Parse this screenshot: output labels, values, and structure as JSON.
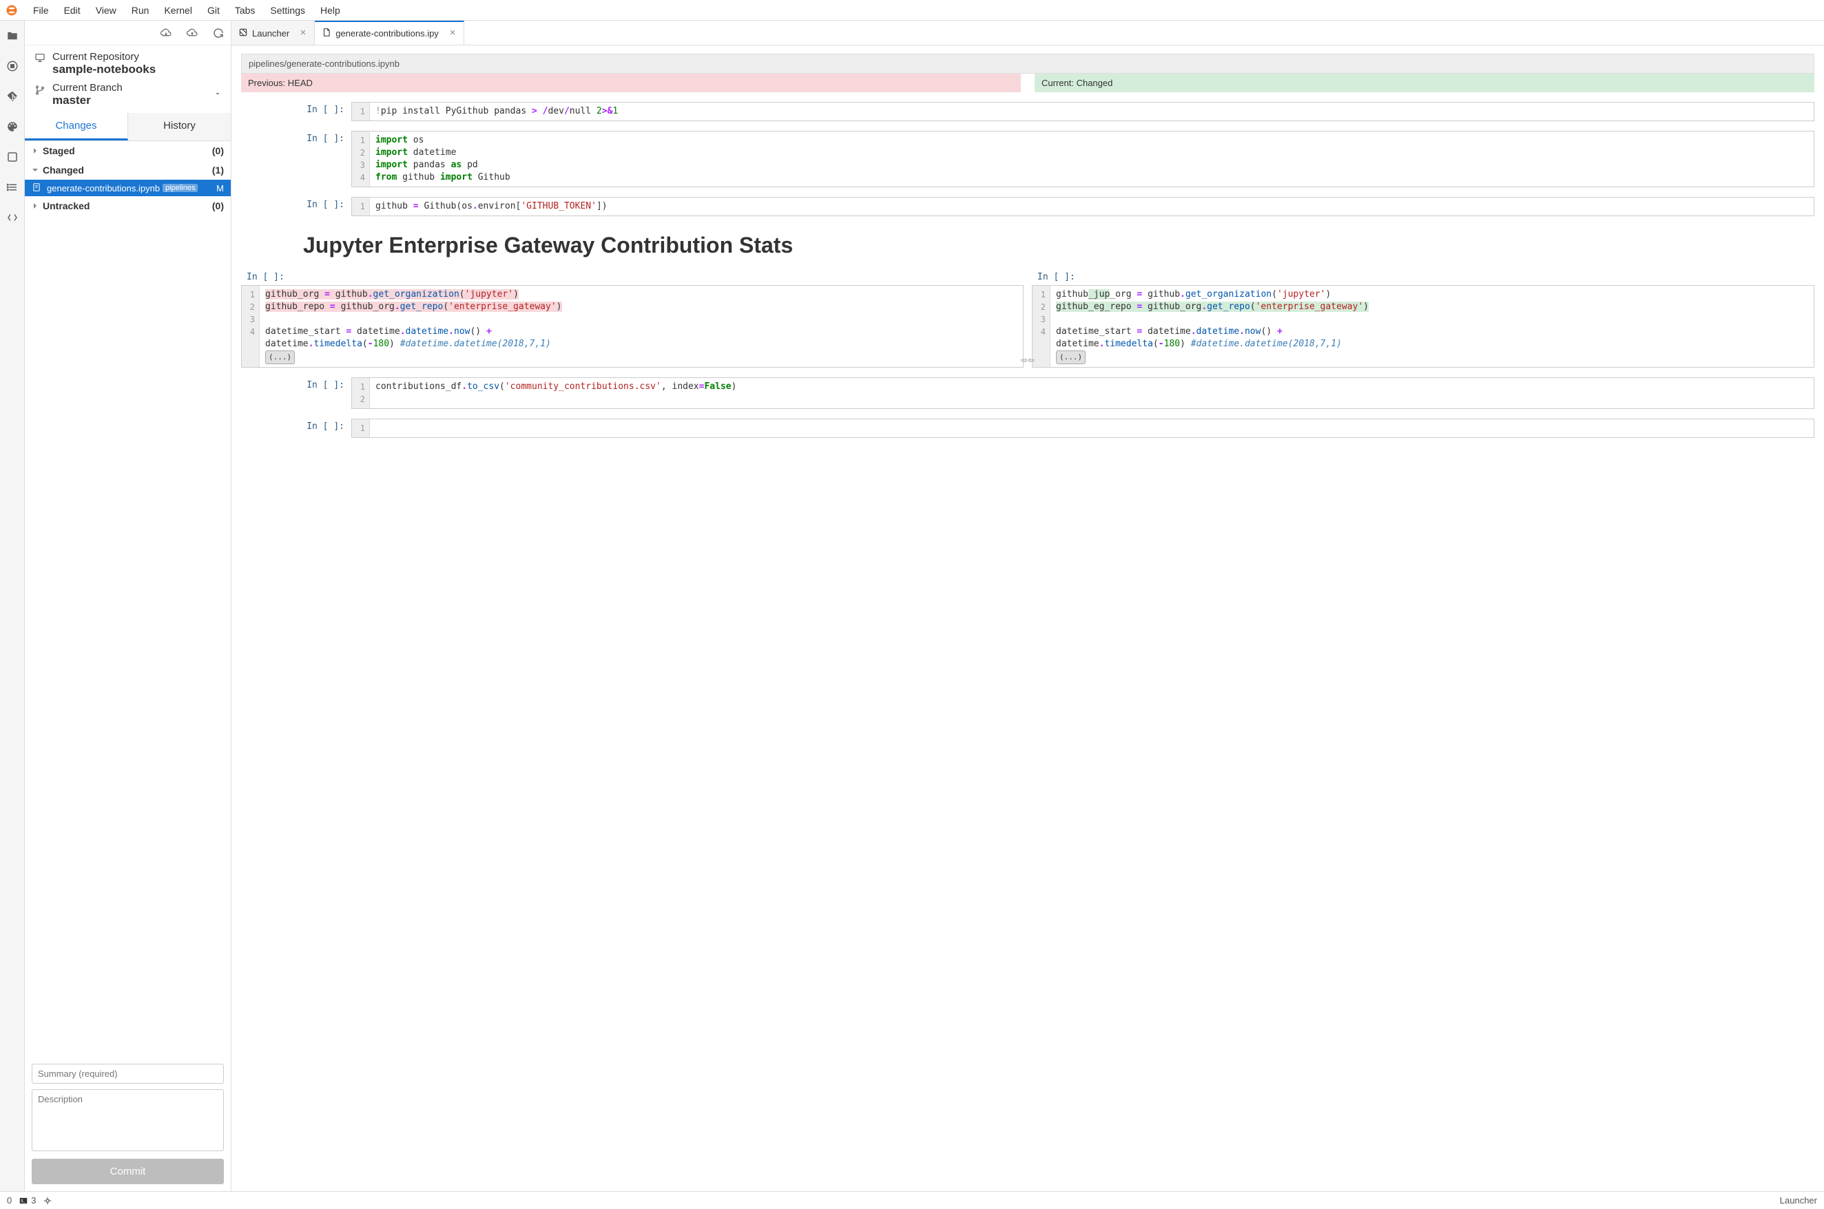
{
  "menubar": {
    "items": [
      "File",
      "Edit",
      "View",
      "Run",
      "Kernel",
      "Git",
      "Tabs",
      "Settings",
      "Help"
    ]
  },
  "git_sidebar": {
    "repo_label": "Current Repository",
    "repo_value": "sample-notebooks",
    "branch_label": "Current Branch",
    "branch_value": "master",
    "tabs": {
      "changes": "Changes",
      "history": "History"
    },
    "sections": {
      "staged": {
        "title": "Staged",
        "count": "(0)"
      },
      "changed": {
        "title": "Changed",
        "count": "(1)"
      },
      "untracked": {
        "title": "Untracked",
        "count": "(0)"
      }
    },
    "changed_file": {
      "name": "generate-contributions.ipynb",
      "path": "pipelines",
      "status": "M"
    },
    "commit": {
      "summary_placeholder": "Summary (required)",
      "description_placeholder": "Description",
      "button": "Commit"
    }
  },
  "tabs": {
    "launcher": "Launcher",
    "diff": "generate-contributions.ipy"
  },
  "diff": {
    "path": "pipelines/generate-contributions.ipynb",
    "prev_label": "Previous: HEAD",
    "curr_label": "Current: Changed",
    "prompt": "In [ ]:",
    "md_title": "Jupyter Enterprise Gateway Contribution Stats",
    "fold": "(...)",
    "code_pip": "!pip install PyGithub pandas > /dev/null 2>&1",
    "code_imports": {
      "l1": "import os",
      "l2": "import datetime",
      "l3": "import pandas as pd",
      "l4": "from github import Github"
    },
    "code_github": "github = Github(os.environ['GITHUB_TOKEN'])",
    "prev_code": {
      "l1": "github_org = github.get_organization('jupyter')",
      "l2": "github_repo = github_org.get_repo('enterprise_gateway')",
      "l3": "",
      "l4a": "datetime_start = datetime.datetime.now() + ",
      "l4b": "datetime.timedelta(-180) #datetime.datetime(2018,7,1)"
    },
    "curr_code": {
      "l1": "github_jup_org = github.get_organization('jupyter')",
      "l2": "github_eg_repo = github_org.get_repo('enterprise_gateway')",
      "l3": "",
      "l4a": "datetime_start = datetime.datetime.now() + ",
      "l4b": "datetime.timedelta(-180) #datetime.datetime(2018,7,1)"
    },
    "code_csv": "contributions_df.to_csv('community_contributions.csv', index=False)"
  },
  "statusbar": {
    "zero": "0",
    "terminals": "3",
    "right": "Launcher"
  }
}
